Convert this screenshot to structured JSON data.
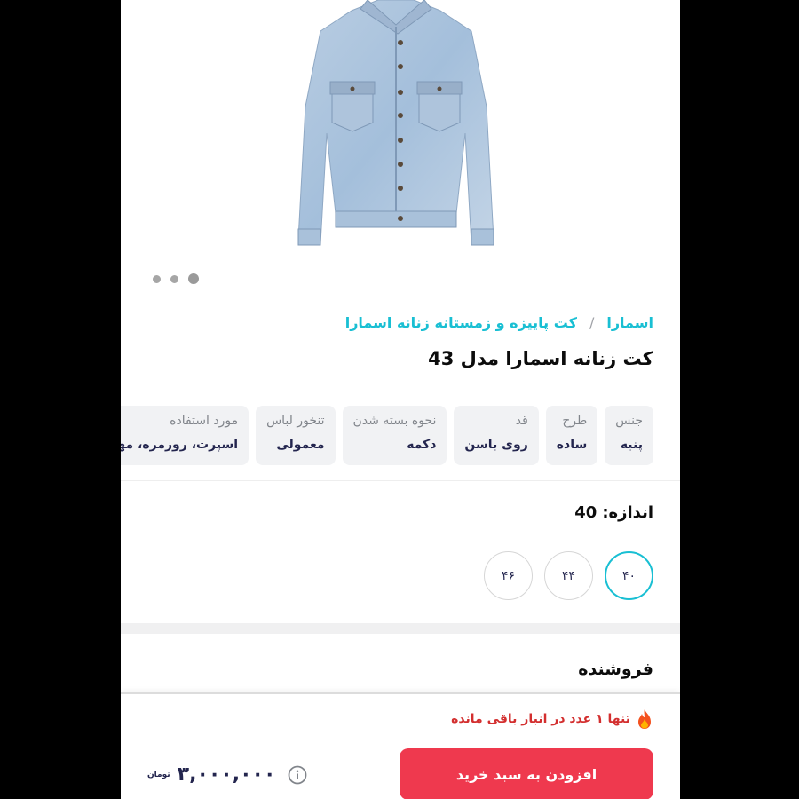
{
  "gallery": {
    "image_icon": "denim-jacket-image",
    "dot_count": 3,
    "active_dot": 3
  },
  "breadcrumb": {
    "brand": "اسمارا",
    "separator": "/",
    "category": "کت پاییزه و زمستانه زنانه اسمارا"
  },
  "product": {
    "title": "کت زنانه اسمارا مدل 43"
  },
  "attributes": [
    {
      "key": "جنس",
      "value": "پنبه"
    },
    {
      "key": "طرح",
      "value": "ساده"
    },
    {
      "key": "قد",
      "value": "روی باسن"
    },
    {
      "key": "نحوه بسته شدن",
      "value": "دکمه"
    },
    {
      "key": "تنخور لباس",
      "value": "معمولی"
    },
    {
      "key": "مورد استفاده",
      "value": "اسپرت، روزمره، مهمانی"
    }
  ],
  "size": {
    "label": "اندازه:",
    "selected": "40",
    "options": [
      "۴۰",
      "۴۴",
      "۴۶"
    ]
  },
  "seller": {
    "title": "فروشنده"
  },
  "bottom_bar": {
    "stock_text": "تنها ۱ عدد در انبار باقی مانده",
    "stock_icon": "fire-icon",
    "add_to_cart": "افزودن به سبد خرید",
    "price": "۳,۰۰۰,۰۰۰",
    "currency": "تومان",
    "info_icon": "info-icon"
  },
  "colors": {
    "accent": "#19bfd3",
    "primary_button": "#ef394e",
    "stock_warning": "#d32f2f"
  }
}
